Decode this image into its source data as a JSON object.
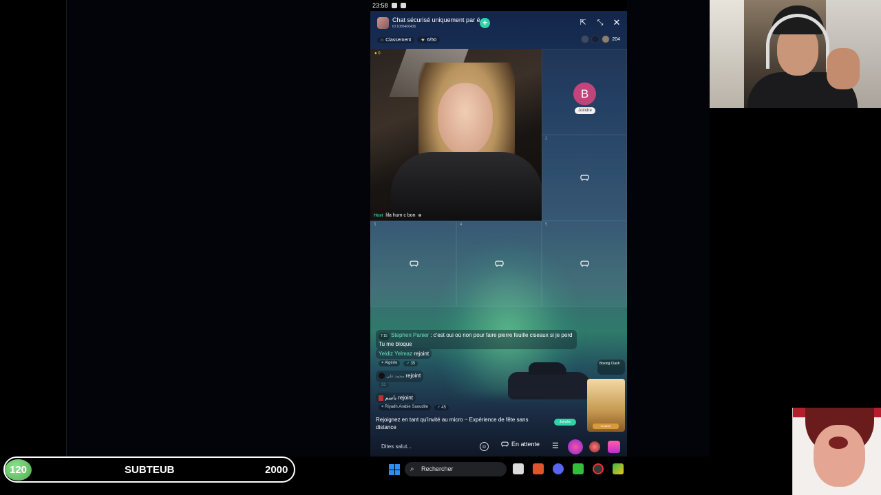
{
  "status": {
    "time": "23:58"
  },
  "room": {
    "title": "Chat sécurisé uniquement par é",
    "id": "ID:1086406436",
    "ranking_label": "Classement",
    "seats_count": "6/50",
    "viewer_count": "204"
  },
  "host": {
    "coins": "0",
    "tag": "Host",
    "caption": "lila hum c bon"
  },
  "seats": {
    "seat_1_initial": "B",
    "seat_1_join": "Joindre",
    "nums": [
      "2",
      "3",
      "4",
      "5"
    ]
  },
  "chat": {
    "messages": [
      {
        "badge": "7 15",
        "name": "Stephen Panier",
        "text": " : c'est oui où non pour faire pierre feuille ciseaux si je perd Tu me bloque"
      },
      {
        "name": "Yeldiz Yelmaz",
        "text": " rejoint",
        "location": "Algérie",
        "level": "35"
      },
      {
        "name": "محمد علي",
        "text": " rejoint",
        "location": "",
        "level": "31"
      },
      {
        "name": "باسم",
        "text": " rejoint",
        "location": "Riyadh,Arabie Saoudite",
        "level": "45"
      }
    ],
    "banner": "Rejoignez en tant qu'invité au micro ~ Expérience de fête sans distance",
    "banner_join": "Joindre"
  },
  "game_ad": {
    "title": "Boxing Clash",
    "button": "Soutenir"
  },
  "bottom": {
    "say_placeholder": "Dites salut...",
    "wait_label": "En attente"
  },
  "overlay": {
    "score": "120",
    "name": "SUBTEUB",
    "goal": "2000"
  },
  "taskbar": {
    "search_label": "Rechercher"
  },
  "colors": {
    "accent": "#2ed3a8",
    "seat_avatar": "#c2447b"
  }
}
